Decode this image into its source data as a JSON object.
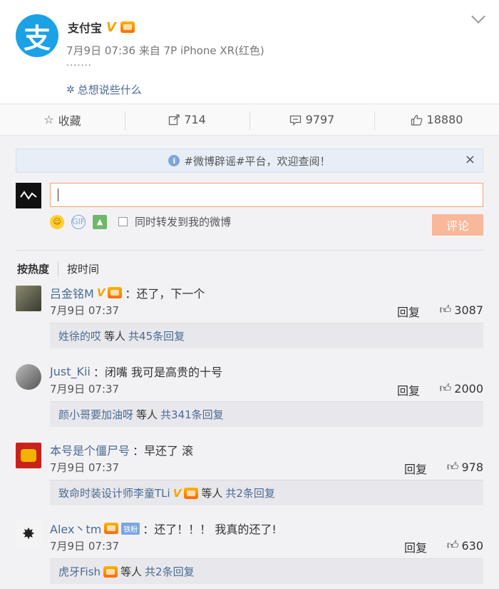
{
  "post": {
    "author": "支付宝",
    "verified_mark": "V",
    "meta": "7月9日 07:36 来自 7P iPhone XR(红色)",
    "content": "·······",
    "say_something": "总想说些什么",
    "avatar_glyph": "支"
  },
  "actions": {
    "favorite": "收藏",
    "repost_count": "714",
    "comment_count": "9797",
    "like_count": "18880"
  },
  "comment_box": {
    "notice": "#微博辟谣#平台，欢迎查阅！",
    "notice_close": "×",
    "input_value": "",
    "repost_also": "同时转发到我的微博",
    "submit": "评论"
  },
  "sort": {
    "hot": "按热度",
    "time": "按时间"
  },
  "comments": [
    {
      "name": "吕金铭M",
      "text": "：还了，下一个",
      "time": "7月9日 07:37",
      "reply": "回复",
      "likes": "3087",
      "sub_name": "姓徐的哎",
      "sub_others": "等人",
      "sub_total": "共45条回复",
      "avatar_color": "#6b6b5a"
    },
    {
      "name": "Just_Kii",
      "text": "：闭嘴 我可是高贵的十号",
      "time": "7月9日 07:37",
      "reply": "回复",
      "likes": "2000",
      "sub_name": "颜小哥要加油呀",
      "sub_others": "等人",
      "sub_total": "共341条回复",
      "avatar_color": "#888880"
    },
    {
      "name": "本号是个僵尸号",
      "text": "：早还了 滚",
      "time": "7月9日 07:37",
      "reply": "回复",
      "likes": "978",
      "sub_name": "致命时装设计师李童TLi",
      "sub_others": "等人",
      "sub_total": "共2条回复",
      "avatar_color": "#c8221a"
    },
    {
      "name": "Alex丶tm",
      "fans_badge": "铁粉",
      "text": "：还了！！！ 我真的还了!",
      "time": "7月9日 07:37",
      "reply": "回复",
      "likes": "630",
      "sub_name": "虎牙Fish",
      "sub_others": "等人",
      "sub_total": "共2条回复",
      "avatar_color": "#dcdcdc"
    }
  ],
  "colors": {
    "link": "#4a6b93",
    "accent": "#f7a400",
    "brand_blue": "#1aa1e6",
    "submit_bg": "#f8b89a"
  }
}
